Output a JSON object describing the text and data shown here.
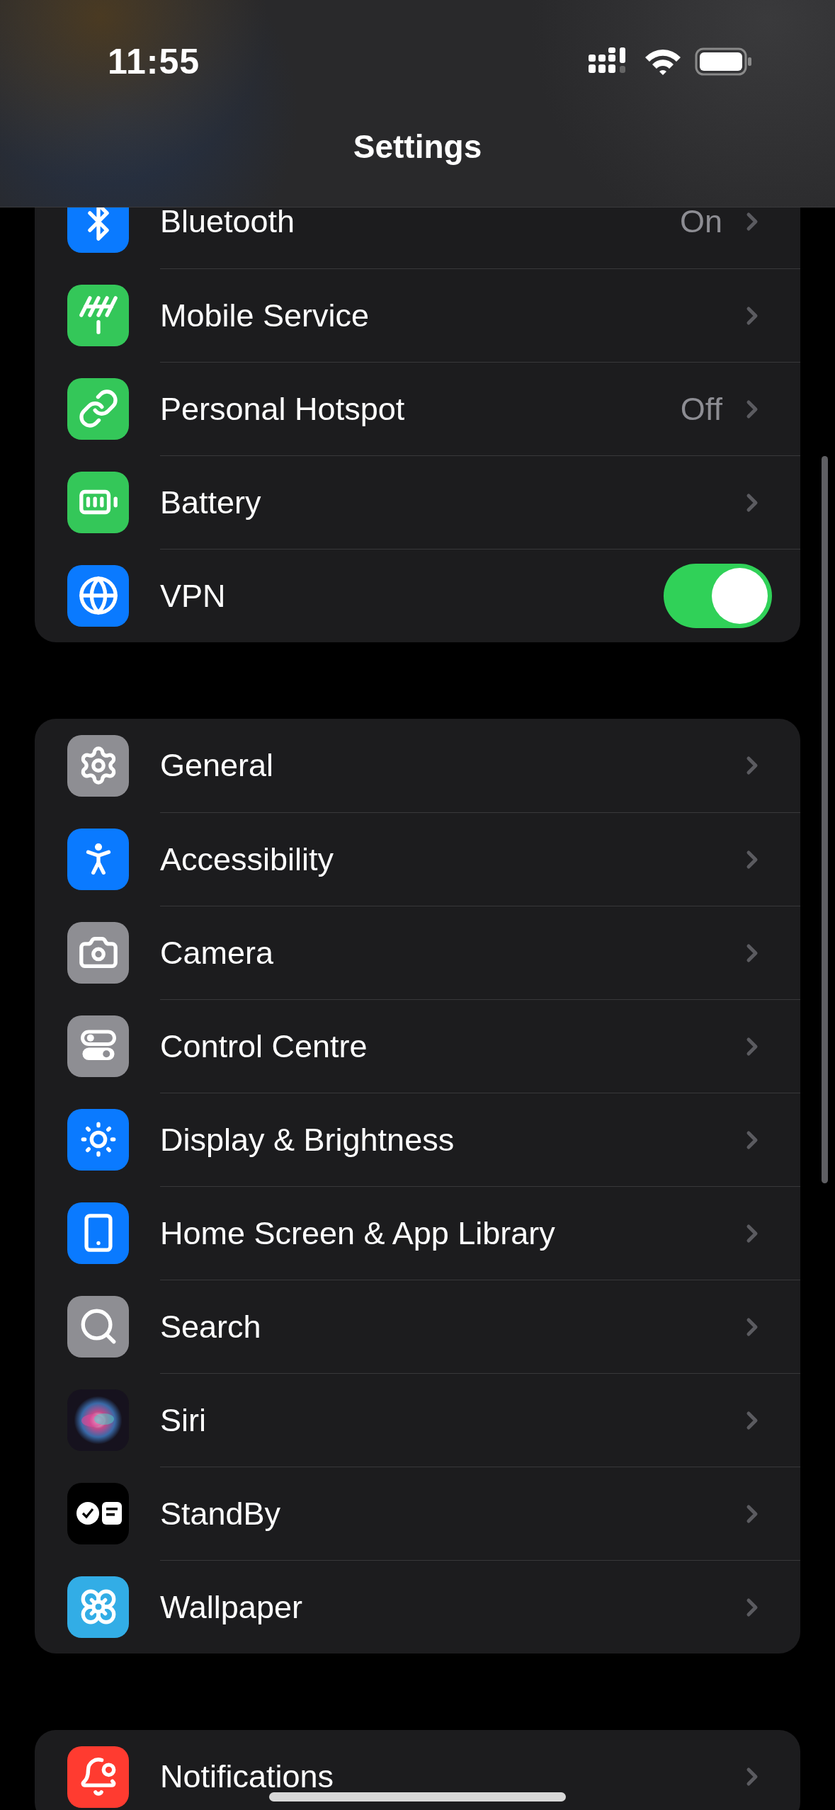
{
  "status_bar": {
    "time": "11:55"
  },
  "nav": {
    "title": "Settings"
  },
  "groups": [
    {
      "rows": [
        {
          "kind": "link",
          "label": "Bluetooth",
          "value": "On",
          "color": "#0a7aff"
        },
        {
          "kind": "link",
          "label": "Mobile Service",
          "color": "#34c759"
        },
        {
          "kind": "link",
          "label": "Personal Hotspot",
          "value": "Off",
          "color": "#34c759"
        },
        {
          "kind": "link",
          "label": "Battery",
          "color": "#34c759"
        },
        {
          "kind": "toggle",
          "label": "VPN",
          "on": true,
          "color": "#0a7aff"
        }
      ]
    },
    {
      "rows": [
        {
          "kind": "link",
          "label": "General",
          "color": "#8e8e93"
        },
        {
          "kind": "link",
          "label": "Accessibility",
          "color": "#0a7aff"
        },
        {
          "kind": "link",
          "label": "Camera",
          "color": "#8e8e93"
        },
        {
          "kind": "link",
          "label": "Control Centre",
          "color": "#8e8e93"
        },
        {
          "kind": "link",
          "label": "Display & Brightness",
          "color": "#0a7aff"
        },
        {
          "kind": "link",
          "label": "Home Screen & App Library",
          "color": "#0a7aff"
        },
        {
          "kind": "link",
          "label": "Search",
          "color": "#8e8e93"
        },
        {
          "kind": "link",
          "label": "Siri",
          "color": "#16121e"
        },
        {
          "kind": "link",
          "label": "StandBy",
          "color": "#000000"
        },
        {
          "kind": "link",
          "label": "Wallpaper",
          "color": "#32ade6"
        }
      ]
    },
    {
      "rows": [
        {
          "kind": "link",
          "label": "Notifications",
          "color": "#ff3b30"
        }
      ]
    }
  ]
}
